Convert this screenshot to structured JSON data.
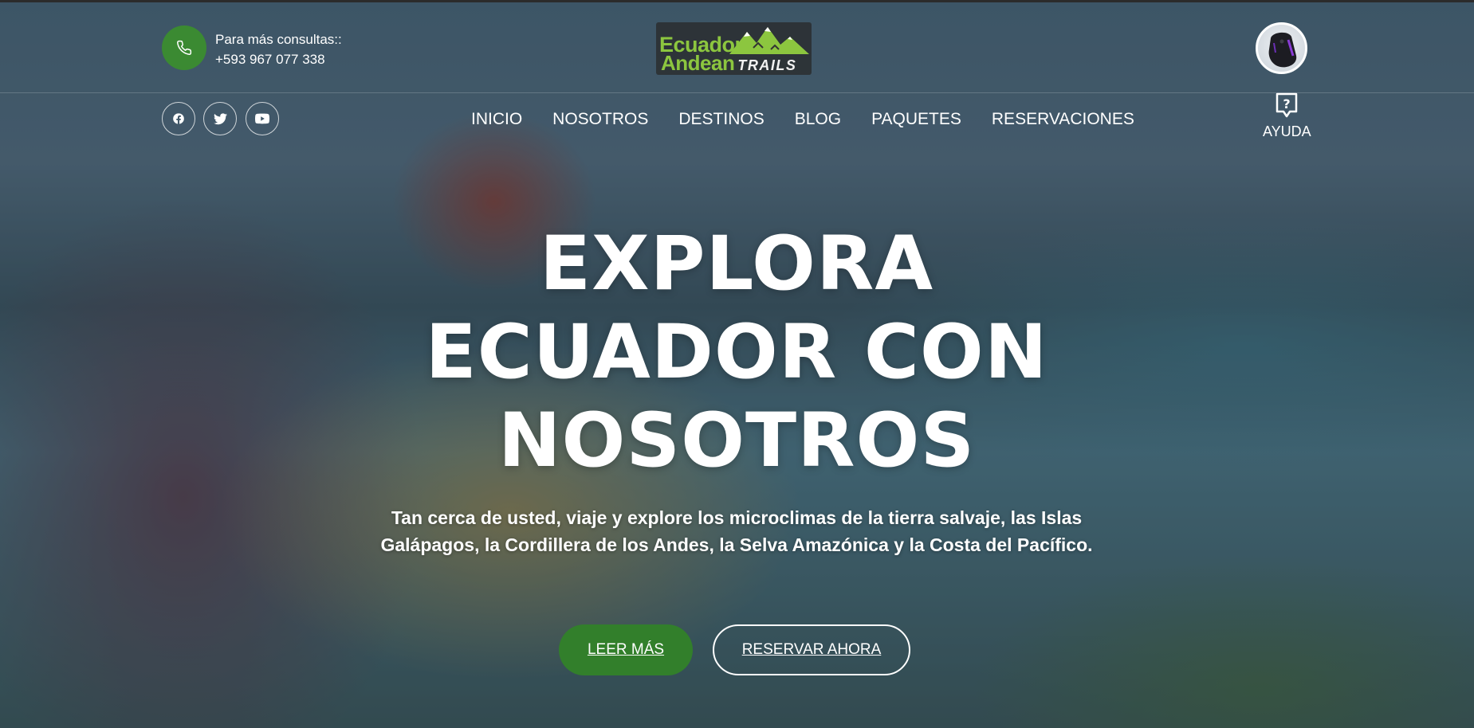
{
  "header": {
    "contact_label": "Para más consultas::",
    "contact_phone": "+593 967 077 338",
    "logo_line1": "Ecuador",
    "logo_line2": "Andean",
    "logo_line2_suffix": "TRAILS"
  },
  "nav": {
    "items": [
      "INICIO",
      "NOSOTROS",
      "DESTINOS",
      "BLOG",
      "PAQUETES",
      "RESERVACIONES"
    ]
  },
  "help": {
    "label": "AYUDA"
  },
  "hero": {
    "headline_line1": "EXPLORA",
    "headline_line2": "ECUADOR CON",
    "headline_line3": "NOSOTROS",
    "subtitle": "Tan cerca de usted, viaje y explore los microclimas de la tierra salvaje, las Islas Galápagos, la Cordillera de los Andes, la Selva Amazónica y la Costa del Pacífico.",
    "primary_button": "LEER MÁS",
    "secondary_button": "RESERVAR AHORA"
  },
  "icons": {
    "phone": "phone-icon",
    "social": [
      "facebook-icon",
      "twitter-icon",
      "youtube-icon"
    ],
    "help": "help-icon",
    "avatar": "gaming-mouse-avatar"
  },
  "colors": {
    "accent_green": "#327f2b",
    "phone_circle": "#3b8a32",
    "logo_green": "#8cc63f"
  }
}
